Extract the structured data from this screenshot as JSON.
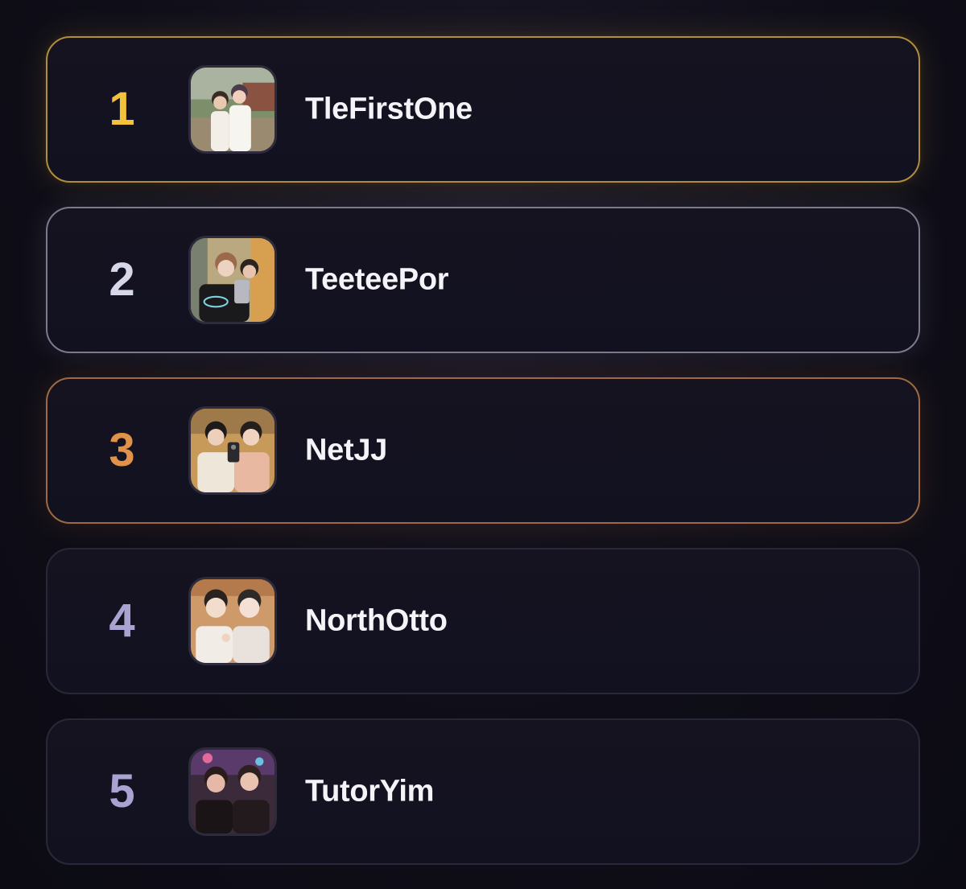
{
  "leaderboard": {
    "entries": [
      {
        "rank": "1",
        "name": "TleFirstOne",
        "tier": "gold",
        "rank_color": "#f2c23a",
        "avatar_icon": "duo-photo-outdoor-icon"
      },
      {
        "rank": "2",
        "name": "TeeteePor",
        "tier": "silver",
        "rank_color": "#d6d8ea",
        "avatar_icon": "duo-photo-selfie-icon"
      },
      {
        "rank": "3",
        "name": "NetJJ",
        "tier": "bronze",
        "rank_color": "#e0924a",
        "avatar_icon": "duo-photo-mirror-icon"
      },
      {
        "rank": "4",
        "name": "NorthOtto",
        "tier": "default",
        "rank_color": "#a8a3d0",
        "avatar_icon": "duo-photo-closeup-icon"
      },
      {
        "rank": "5",
        "name": "TutorYim",
        "tier": "default",
        "rank_color": "#a8a3d0",
        "avatar_icon": "duo-photo-night-icon"
      }
    ]
  }
}
